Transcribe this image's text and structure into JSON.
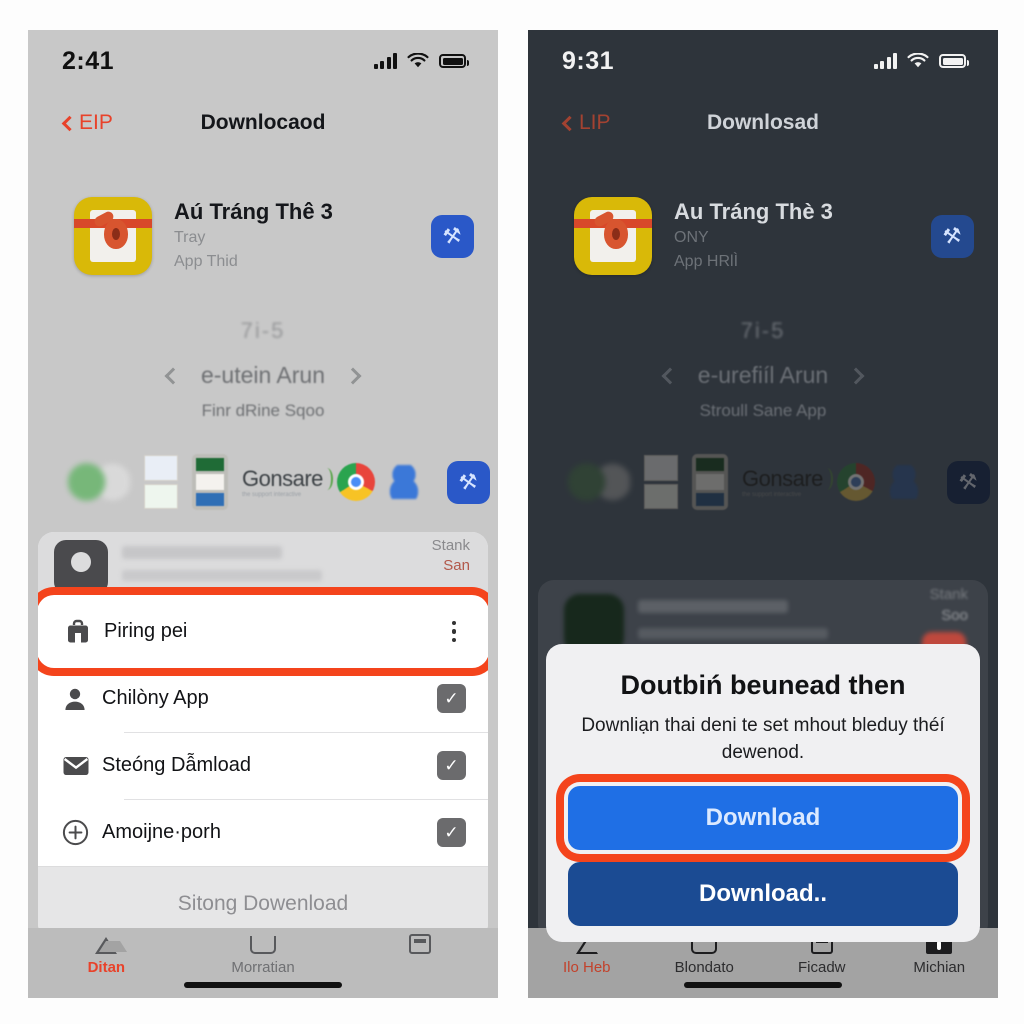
{
  "colors": {
    "accent_red": "#e8422a",
    "highlight_ring": "#f4441c",
    "primary_blue": "#1f6fe5",
    "secondary_blue": "#1b4b93",
    "action_blue": "#2a58c8",
    "app_icon_yellow": "#d9b908"
  },
  "left_phone": {
    "status": {
      "time": "2:41",
      "signal_icon": "cellular-bars-icon",
      "wifi_icon": "wifi-icon",
      "battery_icon": "battery-icon"
    },
    "nav": {
      "back_label": "EIP",
      "back_icon": "chevron-left-icon",
      "title": "Downlocaod"
    },
    "app": {
      "icon_name": "app-icon-key-card",
      "title": "Aú Tráng Thê 3",
      "line1": "Tray",
      "line2": "App Thid",
      "action_icon": "tool-glyph-icon",
      "action_glyph": "⚒"
    },
    "carousel": {
      "smudge": "7i-5",
      "prev_icon": "chevron-left-icon",
      "next_icon": "chevron-right-icon",
      "page_label": "e-utein Arun",
      "caption": "Finr dRine Sqoo",
      "logos": [
        "green-blob-logo",
        "tiles-logo",
        "doc-logo",
        "gonsare-wordmark",
        "chrome-logo",
        "blue-blob-logo"
      ],
      "wordmark": "Gonsare",
      "wordmark_sub": "the support interactive",
      "action_icon": "tool-glyph-icon",
      "action_glyph": "⚒"
    },
    "sheet": {
      "corner_line1": "Stank",
      "corner_line2": "San",
      "rows": [
        {
          "icon": "briefcase-icon",
          "glyph": "\u0000",
          "label": "Piring pei",
          "end": "kebab-menu-icon",
          "highlighted": true
        },
        {
          "icon": "person-icon",
          "glyph": "\u0000",
          "label": "Chilòny App",
          "end": "checkbox-checked-icon",
          "highlighted": false
        },
        {
          "icon": "envelope-icon",
          "glyph": "\u0000",
          "label": "Steóng Dẫmload",
          "end": "checkbox-checked-icon",
          "highlighted": false
        },
        {
          "icon": "plus-circle-icon",
          "glyph": "\u0000",
          "label": "Amoijne·porh",
          "end": "checkbox-checked-icon",
          "highlighted": false
        }
      ],
      "footer_label": "Sitong Dowenload"
    },
    "tabs": [
      {
        "icon": "triangle-icon",
        "label": "Ditan",
        "active": true
      },
      {
        "icon": "tray-icon",
        "label": "Morratian",
        "active": false
      },
      {
        "icon": "card-icon",
        "label": "",
        "active": false
      }
    ]
  },
  "right_phone": {
    "status": {
      "time": "9:31",
      "signal_icon": "cellular-bars-icon",
      "wifi_icon": "wifi-icon",
      "battery_icon": "battery-icon"
    },
    "nav": {
      "back_label": "LIP",
      "back_icon": "chevron-left-icon",
      "title": "Downlosad"
    },
    "app": {
      "icon_name": "app-icon-key-card",
      "title": "Au Tráng Thè 3",
      "line1": "ONY",
      "line2": "App HRlÌ",
      "action_icon": "tool-glyph-icon",
      "action_glyph": "⚒"
    },
    "carousel": {
      "smudge": "7i-5",
      "prev_icon": "chevron-left-icon",
      "next_icon": "chevron-right-icon",
      "page_label": "e-urefiíl Arun",
      "caption": "Stroull Sane App",
      "wordmark": "Gonsare",
      "wordmark_sub": "the support interactive",
      "action_icon": "tool-glyph-icon",
      "action_glyph": "⚒"
    },
    "ghost_sheet": {
      "corner_line1": "Stank",
      "corner_line2": "Soo"
    },
    "alert": {
      "title": "Doutbiń beunead then",
      "message": "Downliạn thai deni te set mhout bleduy théí dewenod.",
      "primary_label": "Download",
      "secondary_label": "Download.."
    },
    "tabs": [
      {
        "icon": "triangle-icon",
        "label": "Ilo Heb",
        "active": true
      },
      {
        "icon": "tray-icon",
        "label": "Blondato",
        "active": false
      },
      {
        "icon": "card-icon",
        "label": "Ficadw",
        "active": false
      },
      {
        "icon": "chip-icon",
        "label": "Michian",
        "active": false
      }
    ]
  }
}
